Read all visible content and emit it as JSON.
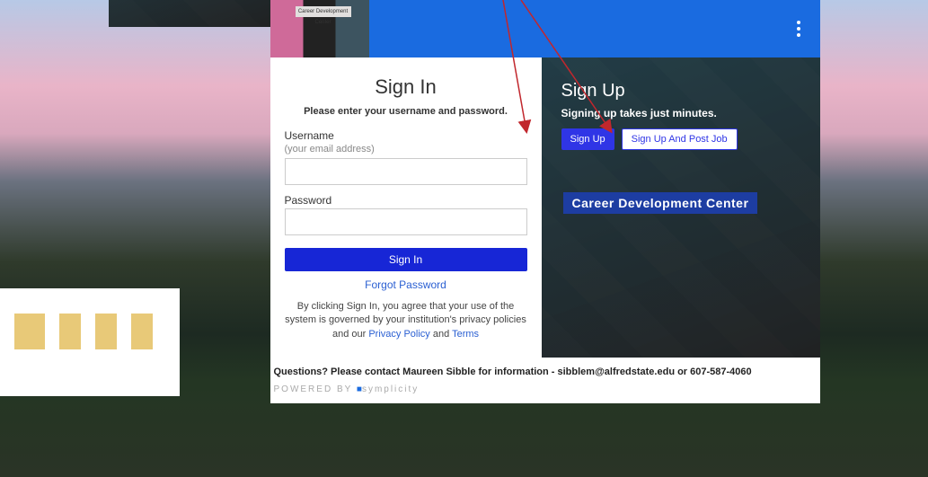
{
  "logo": {
    "tag": "Career Development Center"
  },
  "signin": {
    "title": "Sign In",
    "intro": "Please enter your username and password.",
    "username_label": "Username",
    "username_hint": "(your email address)",
    "password_label": "Password",
    "button": "Sign In",
    "forgot": "Forgot Password",
    "terms_pre": "By clicking Sign In, you agree that your use of the system is governed by your institution's privacy policies and our ",
    "privacy": "Privacy Policy",
    "and": " and ",
    "terms": "Terms"
  },
  "signup": {
    "title": "Sign Up",
    "sub": "Signing up takes just minutes.",
    "btn1": "Sign Up",
    "btn2": "Sign Up And Post Job",
    "badge": "Career Development Center"
  },
  "footer": {
    "contact": "Questions? Please contact Maureen Sibble for information - sibblem@alfredstate.edu or 607-587-4060",
    "powered_pre": "POWERED BY ",
    "powered_brand": "symplicity"
  }
}
